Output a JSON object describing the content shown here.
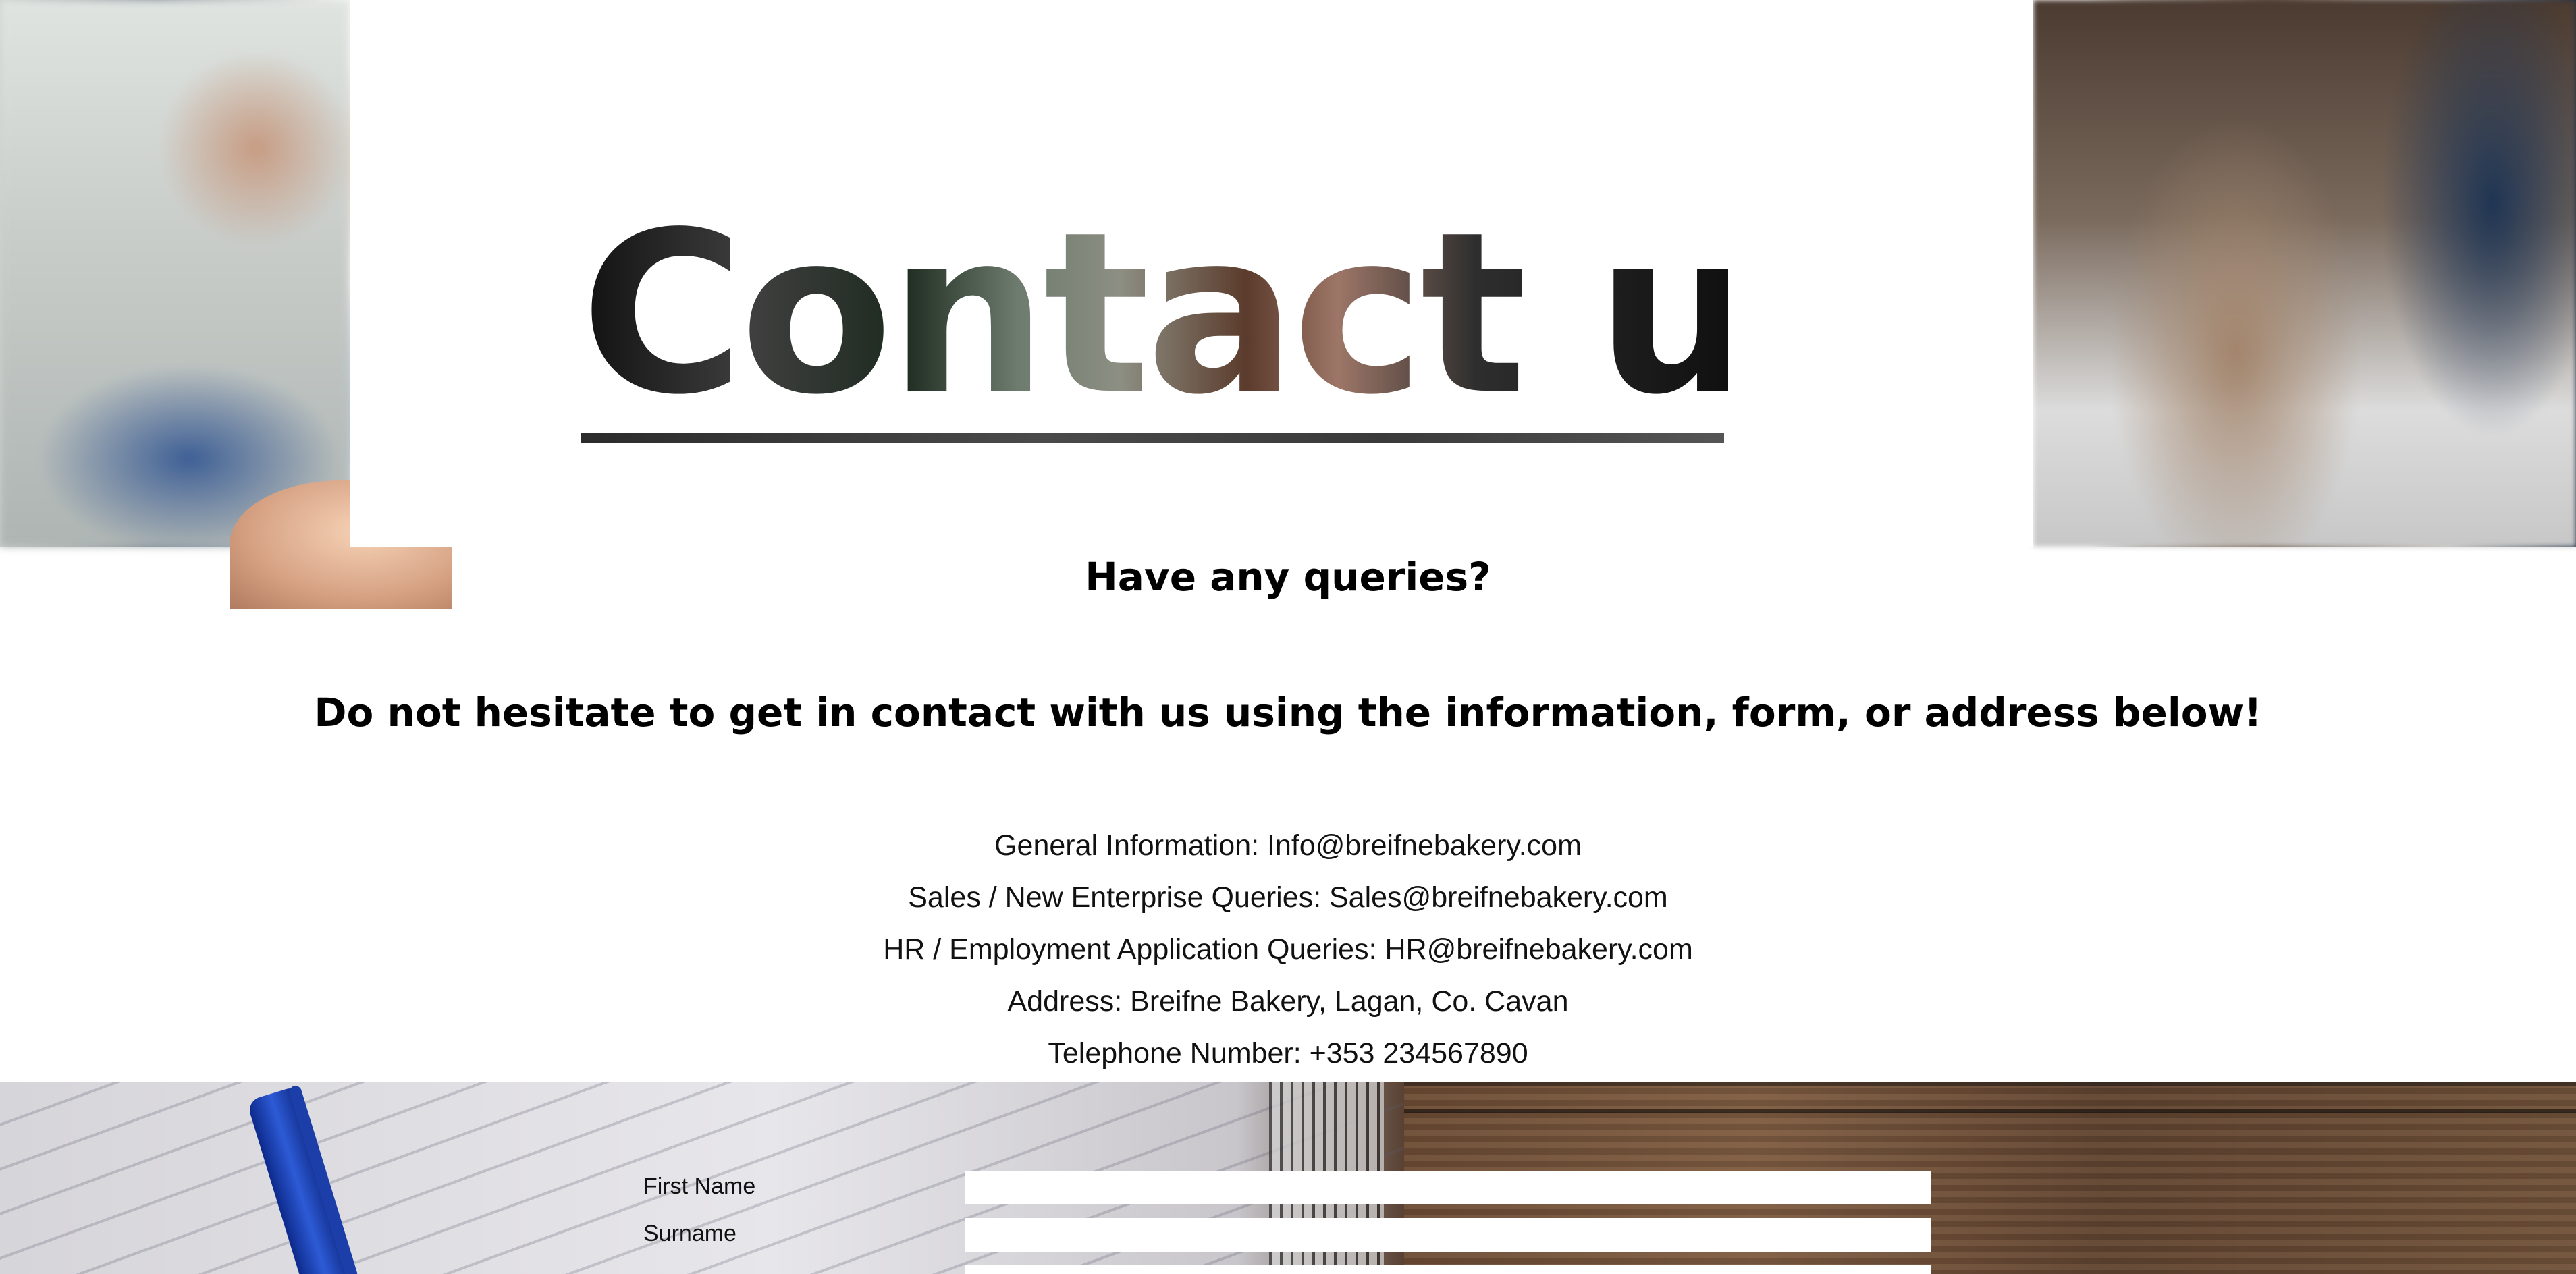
{
  "hero": {
    "title": "Contact us"
  },
  "intro": {
    "heading": "Have any queries?",
    "lead": "Do not hesitate to get in contact with us using the information, form, or address below!"
  },
  "contact_info": [
    "General Information: Info@breifnebakery.com",
    "Sales / New Enterprise Queries: Sales@breifnebakery.com",
    "HR / Employment Application Queries: HR@breifnebakery.com",
    "Address: Breifne Bakery, Lagan, Co. Cavan",
    "Telephone Number: +353 234567890"
  ],
  "form": {
    "fields": [
      {
        "label": "First Name",
        "value": ""
      },
      {
        "label": "Surname",
        "value": ""
      },
      {
        "label": "",
        "value": ""
      }
    ]
  }
}
